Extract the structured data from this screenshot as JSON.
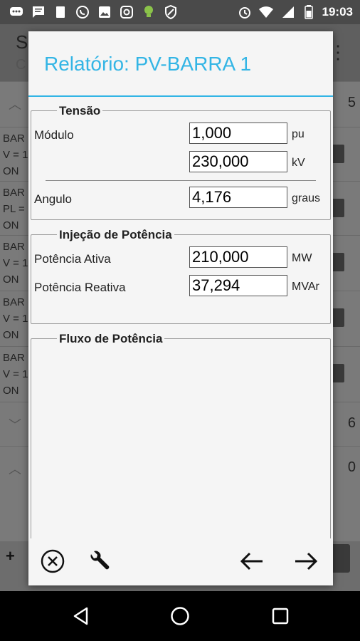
{
  "status_bar": {
    "time": "19:03",
    "icons": [
      "messenger-icon",
      "message-icon",
      "document-icon",
      "whatsapp-icon",
      "image-icon",
      "instagram-icon",
      "lightbulb-icon",
      "shield-icon",
      "alarm-icon",
      "wifi-icon",
      "signal-icon",
      "battery-icon"
    ]
  },
  "background_app": {
    "title": "S",
    "subtitle": "C",
    "items": [
      {
        "lines": [
          "BAR",
          "V = 1",
          "ON"
        ]
      },
      {
        "lines": [
          "BAR",
          "PL =",
          "ON"
        ]
      },
      {
        "lines": [
          "BAR",
          "V = 1",
          "ON"
        ]
      },
      {
        "lines": [
          "BAR",
          "V = 1",
          "ON"
        ]
      },
      {
        "lines": [
          "BAR",
          "V = 1",
          "ON"
        ]
      }
    ],
    "counts": [
      "5",
      "6",
      "0"
    ]
  },
  "dialog": {
    "title": "Relatório: PV-BARRA 1",
    "tensao": {
      "legend": "Tensão",
      "modulo_label": "Módulo",
      "modulo_pu_value": "1,000",
      "modulo_pu_unit": "pu",
      "modulo_kv_value": "230,000",
      "modulo_kv_unit": "kV",
      "angulo_label": "Angulo",
      "angulo_value": "4,176",
      "angulo_unit": "graus"
    },
    "injecao": {
      "legend": "Injeção de Potência",
      "ativa_label": "Potência Ativa",
      "ativa_value": "210,000",
      "ativa_unit": "MW",
      "reativa_label": "Potência Reativa",
      "reativa_value": "37,294",
      "reativa_unit": "MVAr"
    },
    "fluxo": {
      "legend": "Fluxo de Potência"
    },
    "actions": {
      "close": "close-circle-icon",
      "settings": "wrench-icon",
      "previous": "arrow-left-icon",
      "next": "arrow-right-icon"
    }
  },
  "nav_bar": {
    "back": "back-triangle-icon",
    "home": "home-circle-icon",
    "recents": "recents-square-icon"
  },
  "colors": {
    "accent": "#33b5e5",
    "dialog_bg": "#f5f5f5"
  }
}
